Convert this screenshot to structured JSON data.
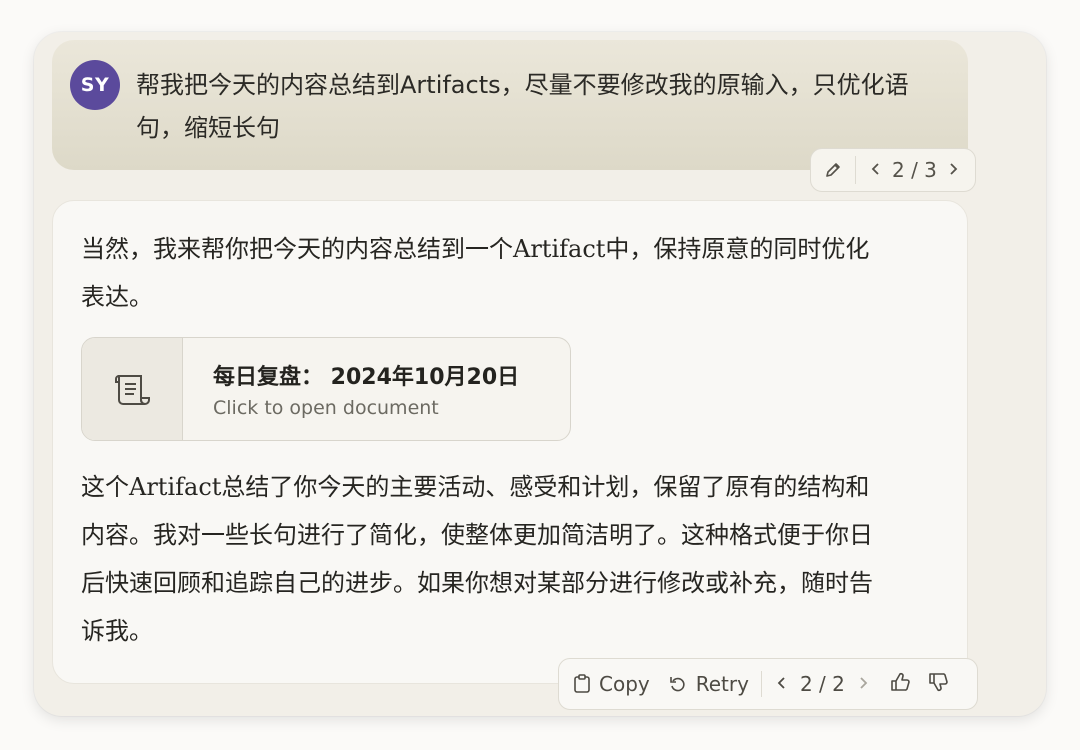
{
  "user": {
    "avatar_initials": "SY",
    "message": "帮我把今天的内容总结到Artifacts，尽量不要修改我的原输入，只优化语句，缩短长句",
    "edit_icon": "pencil-icon",
    "version": "2 / 3"
  },
  "assistant": {
    "intro": "当然，我来帮你把今天的内容总结到一个Artifact中，保持原意的同时优化表达。",
    "artifact": {
      "icon": "scroll-icon",
      "title": "每日复盘： 2024年10月20日",
      "subtitle": "Click to open document"
    },
    "outro": "这个Artifact总结了你今天的主要活动、感受和计划，保留了原有的结构和内容。我对一些长句进行了简化，使整体更加简洁明了。这种格式便于你日后快速回顾和追踪自己的进步。如果你想对某部分进行修改或补充，随时告诉我。"
  },
  "actions": {
    "copy_label": "Copy",
    "retry_label": "Retry",
    "version": "2 / 2",
    "thumbs_up_icon": "thumbs-up-icon",
    "thumbs_down_icon": "thumbs-down-icon"
  }
}
